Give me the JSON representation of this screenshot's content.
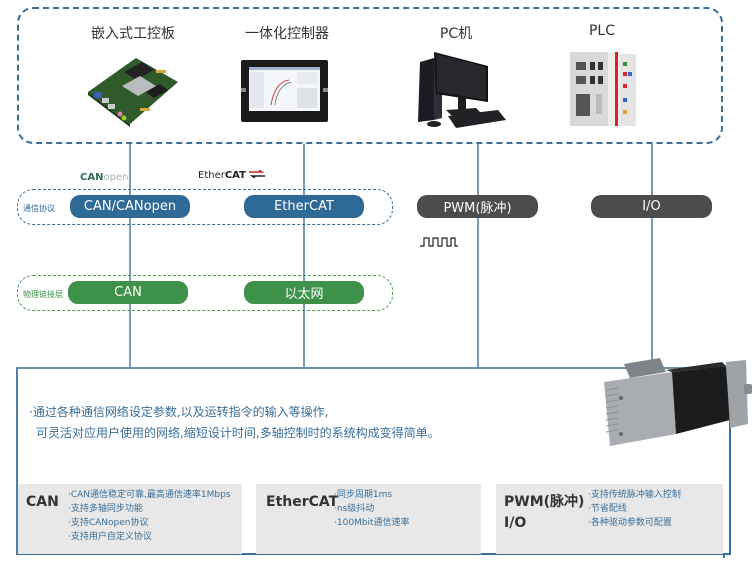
{
  "devices": [
    {
      "label": "嵌入式工控板",
      "icon": "embedded-board-icon"
    },
    {
      "label": "一体化控制器",
      "icon": "integrated-controller-icon"
    },
    {
      "label": "PC机",
      "icon": "pc-icon"
    },
    {
      "label": "PLC",
      "icon": "plc-icon"
    }
  ],
  "logos": {
    "canopen_bold": "CAN",
    "canopen_light": "open",
    "ethercat_light": "Ether",
    "ethercat_bold": "CAT"
  },
  "groups": {
    "protocol_label": "通信协议",
    "physical_label": "物理链接层"
  },
  "protocols": [
    {
      "label": "CAN/CANopen"
    },
    {
      "label": "EtherCAT"
    },
    {
      "label": "PWM(脉冲)"
    },
    {
      "label": "I/O"
    }
  ],
  "physical": [
    {
      "label": "CAN"
    },
    {
      "label": "以太网"
    }
  ],
  "pulse_icon": "pulse-waveform-icon",
  "colors": {
    "blue": "#2f6a97",
    "green": "#3e9148",
    "dark": "#4c4c4c",
    "text_blue": "#3a6f9a",
    "card_bg": "#e8e8e8"
  },
  "description": {
    "line1": "·通过各种通信网络设定参数,以及运转指令的输入等操作,",
    "line2": "可灵活对应用户使用的网络,缩短设计时间,多轴控制时的系统构成变得简单。"
  },
  "features": [
    {
      "title": "CAN",
      "items": [
        "·CAN通信稳定可靠,最高通信速率1Mbps",
        "·支持多轴同步功能",
        "·支持CANopen协议",
        "·支持用户自定义协议"
      ]
    },
    {
      "title": "EtherCAT",
      "items": [
        "·同步周期1ms",
        "·ns级抖动",
        "·100Mbit通信速率"
      ]
    },
    {
      "title_line1": "PWM(脉冲)",
      "title_line2": "I/O",
      "items": [
        "·支持传统脉冲输入控制",
        "·节省配线",
        "·各种驱动参数可配置"
      ]
    }
  ]
}
